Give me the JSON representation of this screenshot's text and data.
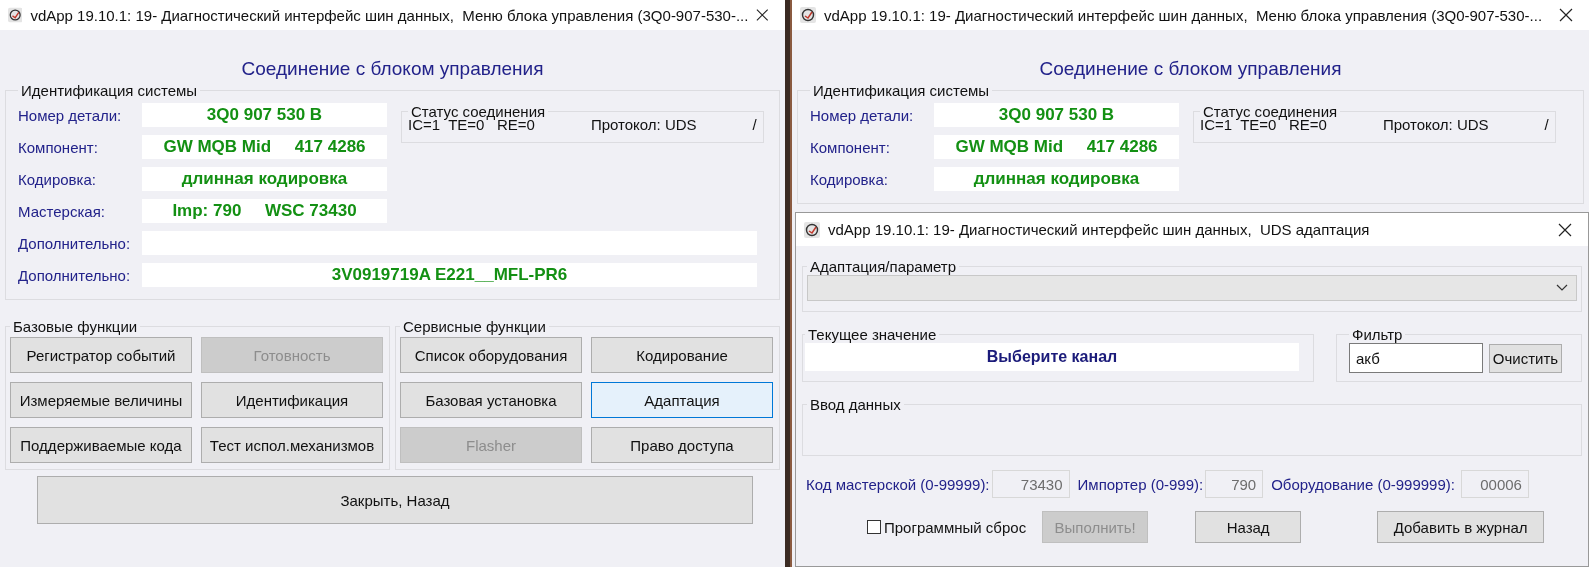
{
  "windows": [
    {
      "title": "vdApp 19.10.1: 19- Диагностический интерфейс шин данных,  Меню блока управления (3Q0-907-530-...",
      "heading": "Соединение с блоком управления",
      "identification": {
        "title": "Идентификация системы",
        "rows": [
          {
            "label": "Номер детали:",
            "value": "3Q0 907 530 B"
          },
          {
            "label": "Компонент:",
            "value": "GW MQB Mid     417 4286"
          },
          {
            "label": "Кодировка:",
            "value": "длинная кодировка"
          },
          {
            "label": "Мастерская:",
            "value": "Imp: 790     WSC 73430"
          }
        ],
        "extra_rows": [
          {
            "label": "Дополнительно:"
          },
          {
            "label": "Дополнительно:",
            "value": "3V0919719A E221__MFL-PR6"
          }
        ]
      },
      "status": {
        "title": "Статус соединения",
        "values": "IC=1  TE=0   RE=0",
        "protocol": "Протокол: UDS",
        "indicator": "/"
      },
      "groups": [
        {
          "title": "Базовые функции",
          "buttons": [
            {
              "label": "Регистратор событий",
              "disabled": false,
              "selected": false
            },
            {
              "label": "Готовность",
              "disabled": true,
              "selected": false
            },
            {
              "label": "Измеряемые величины",
              "disabled": false,
              "selected": false
            },
            {
              "label": "Идентификация",
              "disabled": false,
              "selected": false
            },
            {
              "label": "Поддерживаемые кода",
              "disabled": false,
              "selected": false
            },
            {
              "label": "Тест испол.механизмов",
              "disabled": false,
              "selected": false
            }
          ]
        },
        {
          "title": "Сервисные функции",
          "buttons": [
            {
              "label": "Список оборудования",
              "disabled": false,
              "selected": false
            },
            {
              "label": "Кодирование",
              "disabled": false,
              "selected": false
            },
            {
              "label": "Базовая установка",
              "disabled": false,
              "selected": false
            },
            {
              "label": "Адаптация",
              "disabled": false,
              "selected": true
            },
            {
              "label": "Flasher",
              "disabled": true,
              "selected": false
            },
            {
              "label": "Право доступа",
              "disabled": false,
              "selected": false
            }
          ]
        }
      ],
      "close_button": "Закрыть, Назад"
    },
    {
      "title": "vdApp 19.10.1: 19- Диагностический интерфейс шин данных,  Меню блока управления (3Q0-907-530-...",
      "heading": "Соединение с блоком управления",
      "identification": {
        "title": "Идентификация системы",
        "rows": [
          {
            "label": "Номер детали:",
            "value": "3Q0 907 530 B"
          },
          {
            "label": "Компонент:",
            "value": "GW MQB Mid     417 4286"
          },
          {
            "label": "Кодировка:",
            "value": "длинная кодировка"
          }
        ]
      },
      "status": {
        "title": "Статус соединения",
        "values": "IC=1  TE=0   RE=0",
        "protocol": "Протокол: UDS",
        "indicator": "/"
      }
    }
  ],
  "dialog": {
    "title": "vdApp 19.10.1: 19- Диагностический интерфейс шин данных,  UDS адаптация",
    "adaptation": {
      "title": "Адаптация/параметр"
    },
    "current_value": {
      "title": "Текущее значение",
      "value": "Выберите канал"
    },
    "filter": {
      "title": "Фильтр",
      "value": "акб",
      "button": "Очистить"
    },
    "data_input": {
      "title": "Ввод данных"
    },
    "fields": [
      {
        "label": "Код мастерской (0-99999):",
        "value": "73430",
        "disabled": true
      },
      {
        "label": "Импортер (0-999):",
        "value": "790",
        "disabled": true
      },
      {
        "label": "Оборудование (0-999999):",
        "value": "00006",
        "disabled": true
      }
    ],
    "checkbox": {
      "label": "Программный сброс",
      "checked": false
    },
    "buttons": [
      {
        "label": "Выполнить!",
        "disabled": true
      },
      {
        "label": "Назад",
        "disabled": false
      },
      {
        "label": "Добавить в журнал",
        "disabled": false
      }
    ]
  }
}
